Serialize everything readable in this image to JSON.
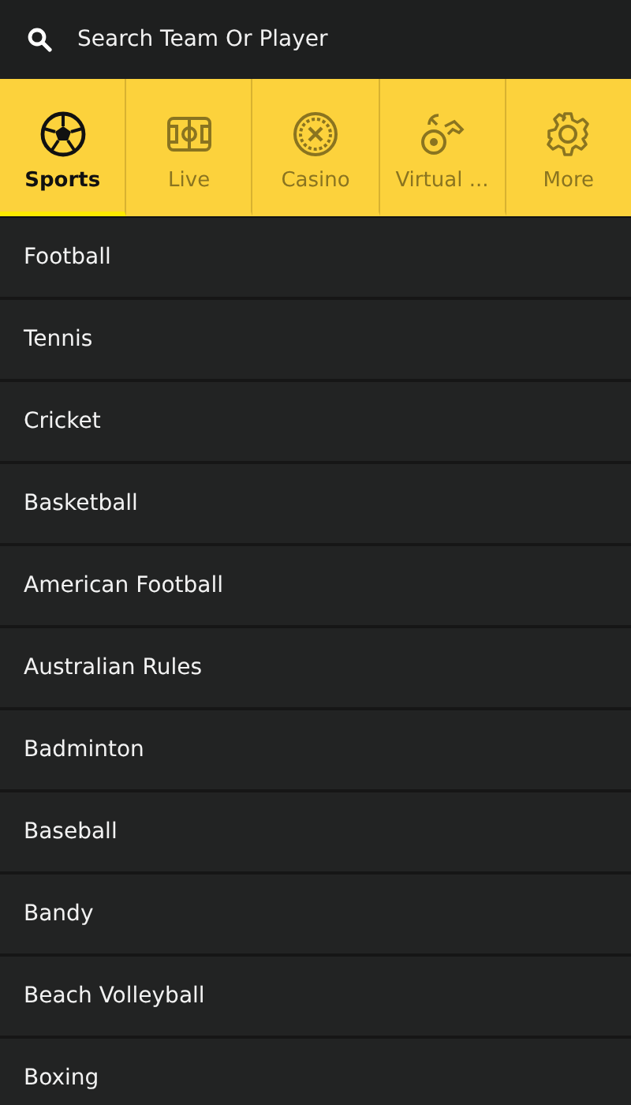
{
  "search": {
    "placeholder": "Search Team Or Player"
  },
  "tabs": [
    {
      "label": "Sports",
      "kind": "ball",
      "selected": true
    },
    {
      "label": "Live",
      "kind": "pitch",
      "selected": false
    },
    {
      "label": "Casino",
      "kind": "roulette",
      "selected": false
    },
    {
      "label": "Virtual ...",
      "kind": "virtual",
      "selected": false
    },
    {
      "label": "More",
      "kind": "gear",
      "selected": false
    }
  ],
  "sports": [
    "Football",
    "Tennis",
    "Cricket",
    "Basketball",
    "American Football",
    "Australian Rules",
    "Badminton",
    "Baseball",
    "Bandy",
    "Beach Volleyball",
    "Boxing"
  ]
}
